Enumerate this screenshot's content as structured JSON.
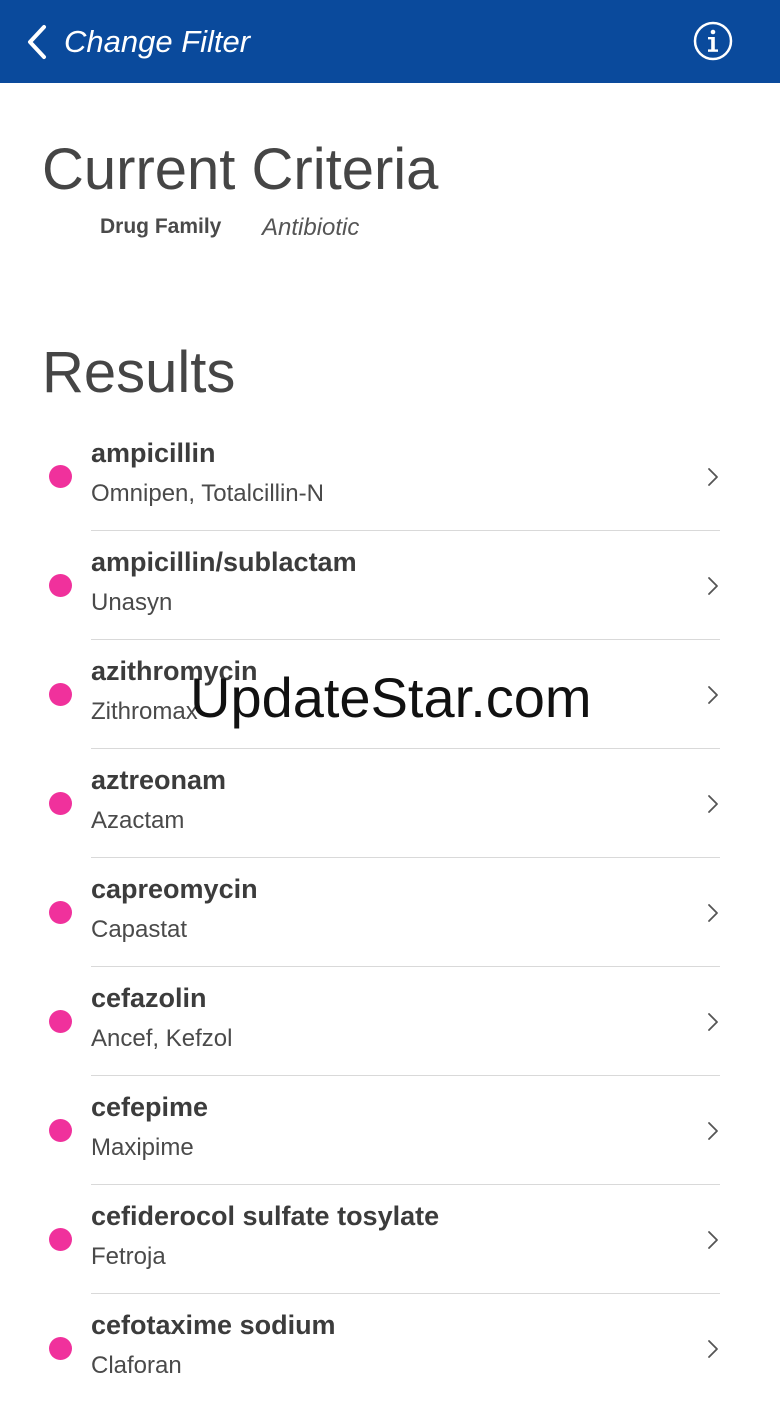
{
  "header": {
    "title": "Change Filter",
    "back_icon": "chevron-left-icon",
    "info_icon": "info-icon",
    "background": "#0a4a9c"
  },
  "criteria": {
    "title": "Current Criteria",
    "label": "Drug Family",
    "value": "Antibiotic"
  },
  "results": {
    "title": "Results",
    "dot_color": "#f0319c",
    "items": [
      {
        "name": "ampicillin",
        "brand": "Omnipen, Totalcillin-N"
      },
      {
        "name": "ampicillin/sublactam",
        "brand": "Unasyn"
      },
      {
        "name": "azithromycin",
        "brand": "Zithromax"
      },
      {
        "name": "aztreonam",
        "brand": "Azactam"
      },
      {
        "name": "capreomycin",
        "brand": "Capastat"
      },
      {
        "name": "cefazolin",
        "brand": "Ancef, Kefzol"
      },
      {
        "name": "cefepime",
        "brand": "Maxipime"
      },
      {
        "name": "cefiderocol sulfate tosylate",
        "brand": "Fetroja"
      },
      {
        "name": "cefotaxime sodium",
        "brand": "Claforan"
      }
    ]
  },
  "watermark": "UpdateStar.com"
}
